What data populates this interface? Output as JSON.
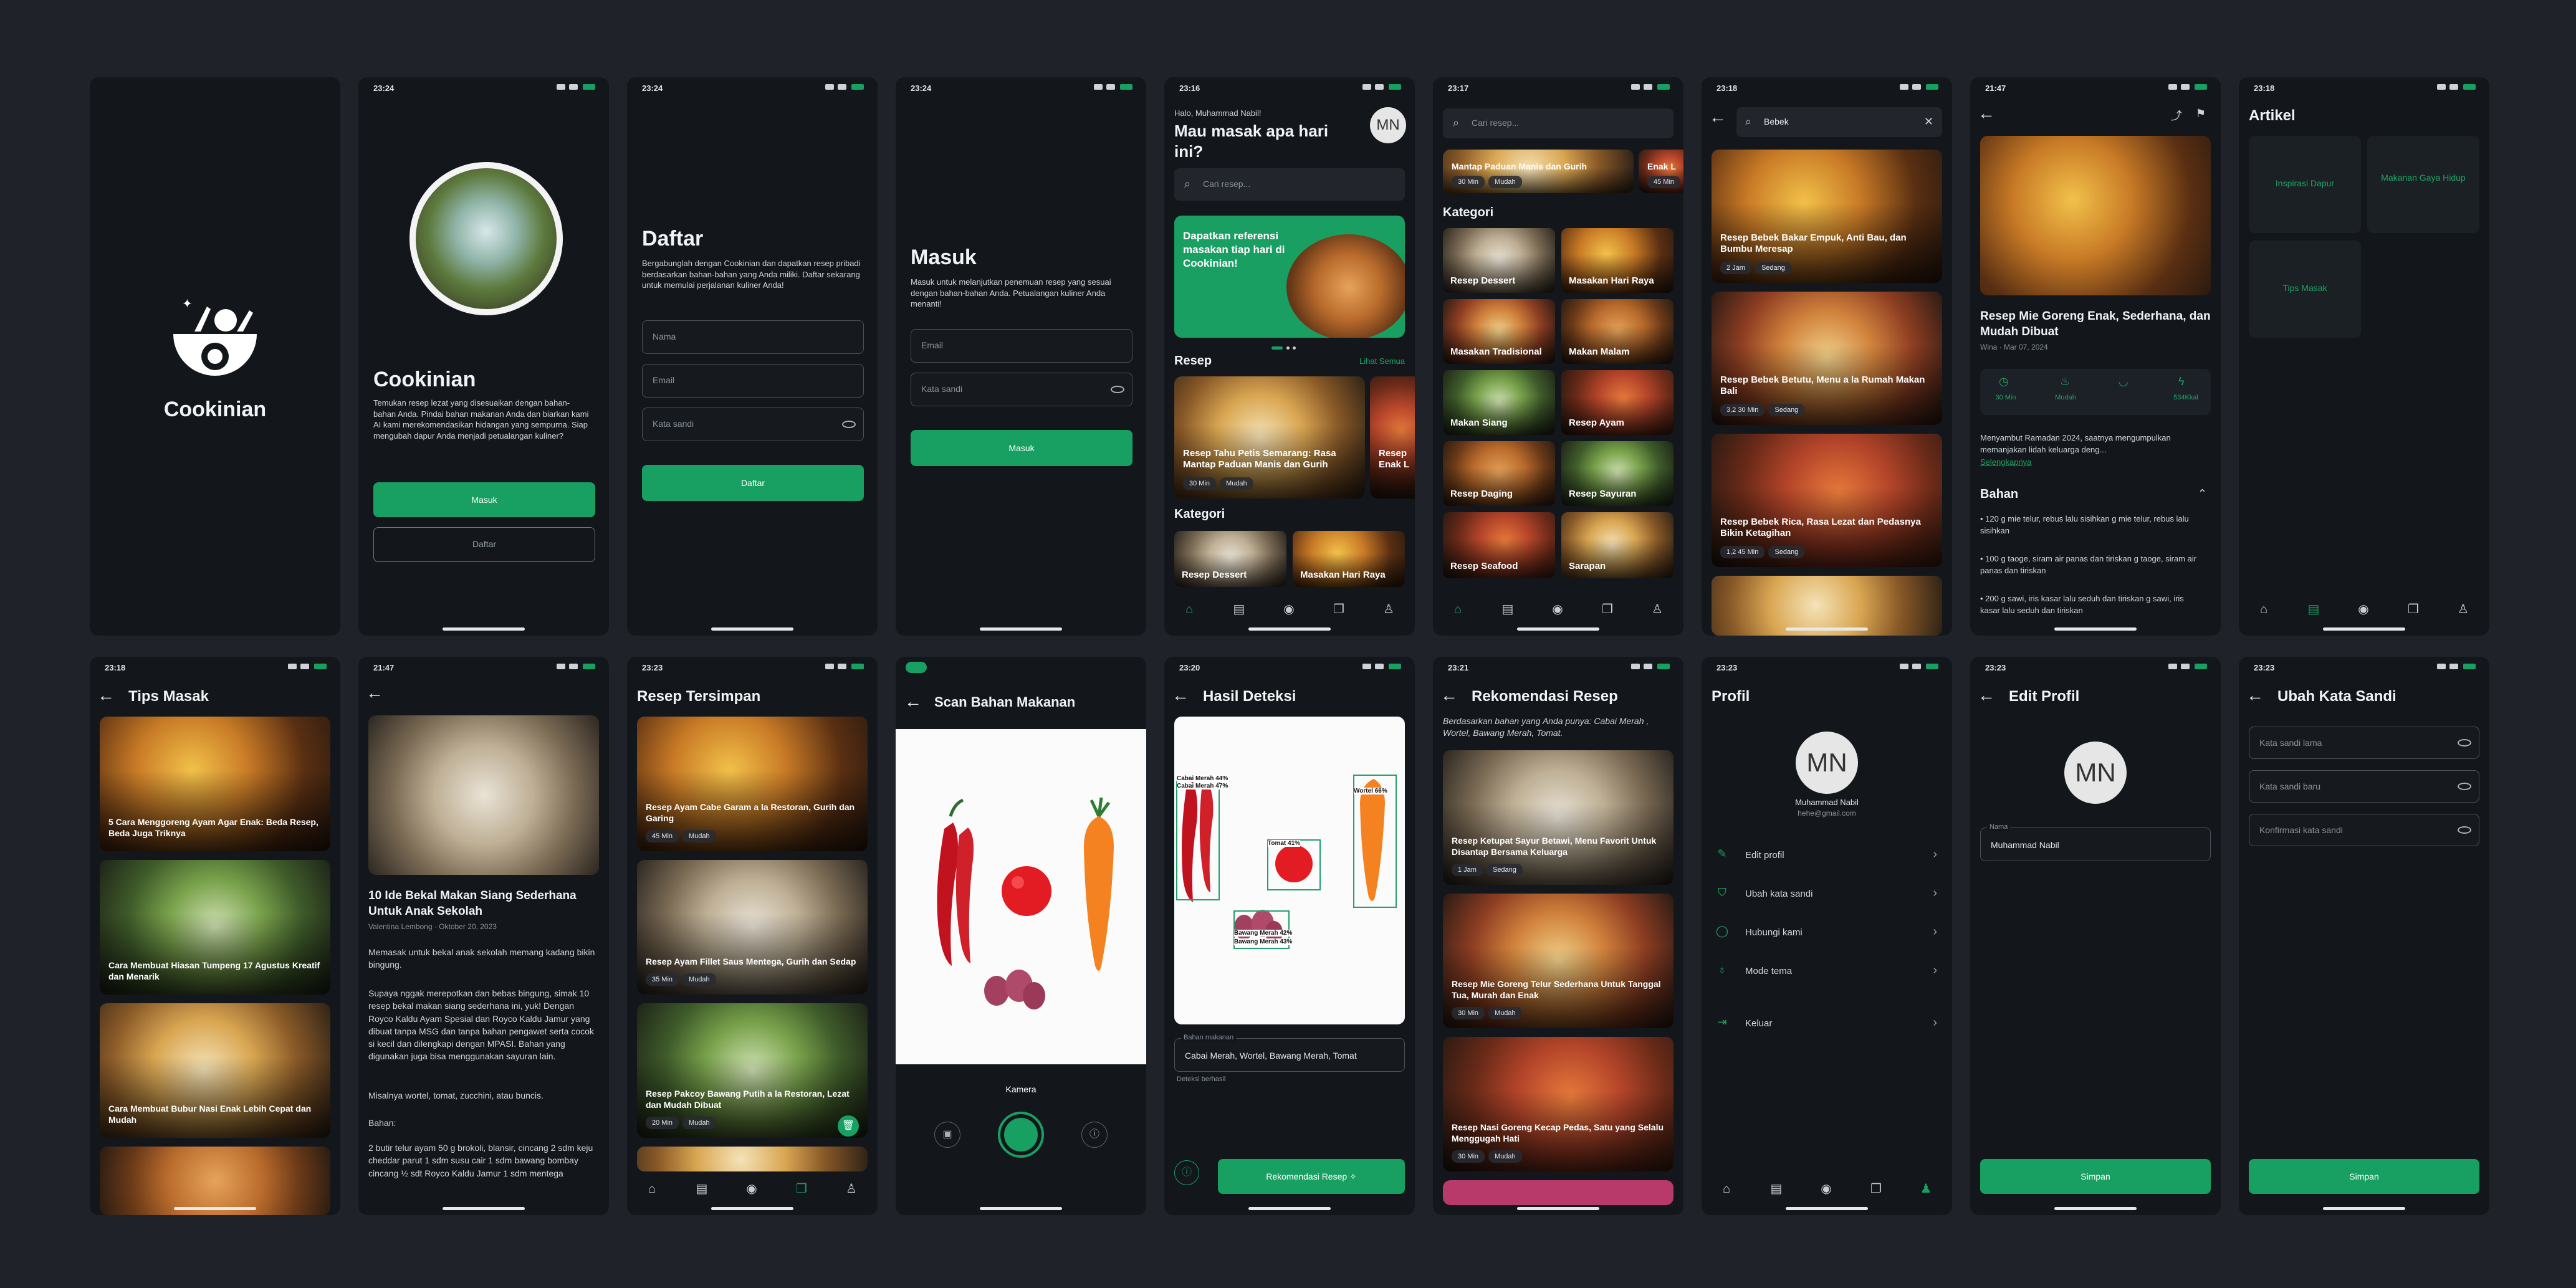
{
  "status": {
    "s2": "23:24",
    "s3": "23:24",
    "s4": "23:24",
    "s5": "23:16",
    "s6": "23:17",
    "s7": "23:18",
    "s8": "21:47",
    "s9": "23:18",
    "s10": "23:18",
    "s11": "21:47",
    "s12": "23:23",
    "s14": "23:20",
    "s15": "23:21",
    "s16": "23:23",
    "s17": "23:23",
    "s18": "23:23"
  },
  "splash": {
    "brand": "Cookinian"
  },
  "onboard": {
    "title": "Cookinian",
    "desc": "Temukan resep lezat yang disesuaikan dengan bahan-bahan Anda. Pindai bahan makanan Anda dan biarkan kami AI kami merekomendasikan hidangan yang sempurna. Siap mengubah dapur Anda menjadi petualangan kuliner?",
    "login": "Masuk",
    "register": "Daftar"
  },
  "daftar": {
    "title": "Daftar",
    "desc": "Bergabunglah dengan Cookinian dan dapatkan resep pribadi berdasarkan bahan-bahan yang Anda miliki. Daftar sekarang untuk memulai perjalanan kuliner Anda!",
    "nama": "Nama",
    "email": "Email",
    "sandi": "Kata sandi",
    "btn": "Daftar"
  },
  "masuk": {
    "title": "Masuk",
    "desc": "Masuk untuk melanjutkan penemuan resep yang sesuai dengan bahan-bahan Anda. Petualangan kuliner Anda menanti!",
    "email": "Email",
    "sandi": "Kata sandi",
    "btn": "Masuk"
  },
  "home": {
    "greet": "Halo, Muhammad Nabil!",
    "question": "Mau masak apa hari ini?",
    "avatar": "MN",
    "search": "Cari resep...",
    "banner": "Dapatkan referensi masakan tiap hari di Cookinian!",
    "resep": "Resep",
    "lihat": "Lihat Semua",
    "card1": "Resep Tahu Petis Semarang: Rasa Mantap Paduan Manis dan Gurih",
    "card1_t1": "30 Min",
    "card1_t2": "Mudah",
    "card2": "Resep Enak L",
    "kategori": "Kategori",
    "kat1": "Resep Dessert",
    "kat2": "Masakan Hari Raya"
  },
  "browse": {
    "search": "Cari resep...",
    "top": "Mantap Paduan Manis dan Gurih",
    "top_t1": "30 Min",
    "top_t2": "Mudah",
    "top2": "Enak L",
    "top2_t": "45 Min",
    "kategori": "Kategori",
    "k1": "Resep Dessert",
    "k2": "Masakan Hari Raya",
    "k3": "Masakan Tradisional",
    "k4": "Makan Malam",
    "k5": "Makan Siang",
    "k6": "Resep Ayam",
    "k7": "Resep Daging",
    "k8": "Resep Sayuran",
    "k9": "Resep Seafood",
    "k10": "Sarapan"
  },
  "searchres": {
    "query": "Bebek",
    "r1": "Resep Bebek Bakar Empuk, Anti Bau, dan Bumbu Meresap",
    "r1_t1": "2 Jam",
    "r1_t2": "Sedang",
    "r2": "Resep Bebek Betutu, Menu a la Rumah Makan Bali",
    "r2_t1": "3,2 30 Min",
    "r2_t2": "Sedang",
    "r3": "Resep Bebek Rica, Rasa Lezat dan Pedasnya Bikin Ketagihan",
    "r3_t1": "1,2 45 Min",
    "r3_t2": "Sedang"
  },
  "detail": {
    "title": "Resep Mie Goreng Enak, Sederhana, dan Mudah Dibuat",
    "meta": "Wina · Mar 07, 2024",
    "s1": "30 Min",
    "s2": "Mudah",
    "s3": "",
    "s4": "534Kkal",
    "intro": "Menyambut Ramadan 2024, saatnya mengumpulkan memanjakan lidah keluarga deng...",
    "more": "Selengkapnya",
    "bahan": "Bahan",
    "b1": "• 120 g mie telur, rebus lalu sisihkan g mie telur, rebus lalu sisihkan",
    "b2": "• 100 g taoge, siram air panas dan tiriskan g taoge, siram air panas dan tiriskan",
    "b3": "• 200 g sawi, iris kasar lalu seduh dan tiriskan g sawi, iris kasar lalu seduh dan tiriskan"
  },
  "artikel": {
    "title": "Artikel",
    "a1": "Inspirasi Dapur",
    "a2": "Makanan Gaya Hidup",
    "a3": "Tips Masak"
  },
  "tips": {
    "title": "Tips Masak",
    "t1": "5 Cara Menggoreng Ayam Agar Enak: Beda Resep, Beda Juga Triknya",
    "t2": "Cara Membuat Hiasan Tumpeng 17 Agustus Kreatif dan Menarik",
    "t3": "Cara Membuat Bubur Nasi Enak Lebih Cepat dan Mudah"
  },
  "article": {
    "title": "10 Ide Bekal Makan Siang Sederhana Untuk Anak Sekolah",
    "meta": "Valentina Lembong · Oktober 20, 2023",
    "p1": "Memasak untuk bekal anak sekolah memang kadang bikin bingung.",
    "p2": "Supaya nggak merepotkan dan bebas bingung, simak 10 resep bekal makan siang sederhana ini, yuk! Dengan Royco Kaldu Ayam Spesial dan Royco Kaldu Jamur yang dibuat tanpa MSG dan tanpa bahan pengawet serta cocok si kecil dan dilengkapi dengan MPASI. Bahan yang digunakan juga bisa menggunakan sayuran lain.",
    "p3": "Misalnya wortel, tomat, zucchini, atau buncis.",
    "p4": "Bahan:",
    "p5": "2 butir telur ayam 50 g brokoli, blansir, cincang 2 sdm keju cheddar parut 1 sdm susu cair 1 sdm bawang bombay cincang ½ sdt Royco Kaldu Jamur 1 sdm mentega"
  },
  "saved": {
    "title": "Resep Tersimpan",
    "s1": "Resep Ayam Cabe Garam a la Restoran, Gurih dan Garing",
    "s1_t1": "45 Min",
    "s1_t2": "Mudah",
    "s2": "Resep Ayam Fillet Saus Mentega, Gurih dan Sedap",
    "s2_t1": "35 Min",
    "s2_t2": "Mudah",
    "s3": "Resep Pakcoy Bawang Putih a la Restoran, Lezat dan Mudah Dibuat",
    "s3_t1": "20 Min",
    "s3_t2": "Mudah"
  },
  "scan": {
    "title": "Scan Bahan Makanan",
    "mode": "Kamera"
  },
  "hasil": {
    "title": "Hasil Deteksi",
    "d1": "Cabai Merah 44%",
    "d2": "Cabai Merah 47%",
    "d3": "Wortel 66%",
    "d4": "Tomat 41%",
    "d5": "Bawang Merah 42%",
    "d6": "Bawang Merah 43%",
    "label": "Bahan makanan",
    "value": "Cabai Merah, Wortel, Bawang Merah, Tomat",
    "hint": "Deteksi berhasil",
    "btn": "Rekomendasi Resep"
  },
  "rekom": {
    "title": "Rekomendasi Resep",
    "sub": "Berdasarkan bahan yang Anda punya: Cabai Merah , Wortel, Bawang Merah, Tomat.",
    "r1": "Resep Ketupat Sayur Betawi, Menu Favorit Untuk Disantap Bersama Keluarga",
    "r1_t1": "1 Jam",
    "r1_t2": "Sedang",
    "r2": "Resep Mie Goreng Telur Sederhana Untuk Tanggal Tua, Murah dan Enak",
    "r2_t1": "30 Min",
    "r2_t2": "Mudah",
    "r3": "Resep Nasi Goreng Kecap Pedas, Satu yang Selalu Menggugah Hati",
    "r3_t1": "30 Min",
    "r3_t2": "Mudah"
  },
  "profil": {
    "title": "Profil",
    "avatar": "MN",
    "name": "Muhammad Nabil",
    "email": "hehe@gmail.com",
    "m1": "Edit profil",
    "m2": "Ubah kata sandi",
    "m3": "Hubungi kami",
    "m4": "Mode tema",
    "m5": "Keluar"
  },
  "edit": {
    "title": "Edit Profil",
    "avatar": "MN",
    "label": "Nama",
    "value": "Muhammad Nabil",
    "btn": "Simpan"
  },
  "pass": {
    "title": "Ubah Kata Sandi",
    "f1": "Kata sandi lama",
    "f2": "Kata sandi baru",
    "f3": "Konfirmasi kata sandi",
    "btn": "Simpan"
  },
  "colors": {
    "accent": "#18a062",
    "bg": "#13171c",
    "canvas": "#1f2228"
  }
}
